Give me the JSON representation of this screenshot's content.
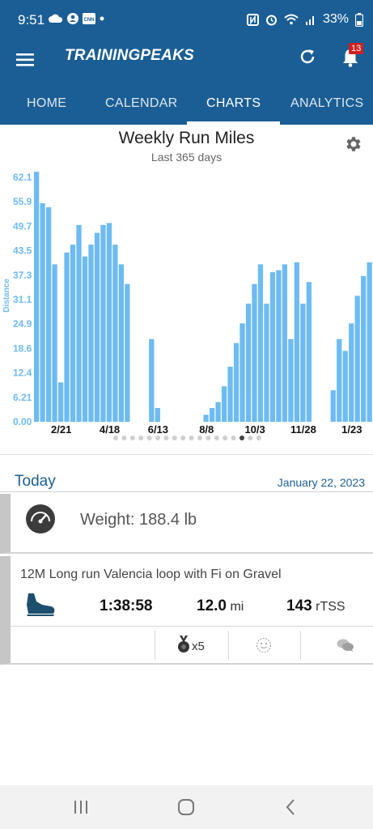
{
  "status": {
    "time": "9:51",
    "battery": "33%",
    "left_icons": [
      "cloud-icon",
      "account-icon",
      "cnn-icon",
      "dot-icon"
    ],
    "right_icons": [
      "nfc-icon",
      "alarm-icon",
      "wifi-icon",
      "signal-icon"
    ]
  },
  "header": {
    "brand": "TRAININGPEAKS",
    "notification_count": "13"
  },
  "tabs": [
    {
      "label": "HOME"
    },
    {
      "label": "CALENDAR"
    },
    {
      "label": "CHARTS",
      "active": true
    },
    {
      "label": "ANALYTICS"
    }
  ],
  "chart": {
    "title": "Weekly Run Miles",
    "subtitle": "Last 365 days",
    "page_dots": {
      "count": 18,
      "active_index": 15
    }
  },
  "chart_data": {
    "type": "bar",
    "title": "Weekly Run Miles",
    "subtitle": "Last 365 days",
    "xlabel": "",
    "ylabel": "Distance",
    "ylim": [
      0,
      62.1
    ],
    "y_ticks": [
      "0.00",
      "6.21",
      "12.4",
      "18.6",
      "24.9",
      "31.1",
      "37.3",
      "43.5",
      "49.7",
      "55.9",
      "62.1"
    ],
    "x_ticks": [
      "2/21",
      "4/18",
      "6/13",
      "8/8",
      "10/3",
      "11/28",
      "1/23"
    ],
    "bar_color": "#6dbbf2",
    "values": [
      63.5,
      55.5,
      54.5,
      40.0,
      10.0,
      43.0,
      45.0,
      50.0,
      42.0,
      45.0,
      48.0,
      50.0,
      50.5,
      45.0,
      40.0,
      35.0,
      0,
      0,
      0,
      21.0,
      3.5,
      0,
      0,
      0,
      0,
      0,
      0,
      0,
      1.8,
      3.5,
      5.0,
      9.0,
      14.0,
      20.0,
      25.0,
      30.0,
      35.0,
      40.0,
      30.0,
      38.0,
      38.5,
      40.0,
      21.0,
      40.5,
      30.0,
      35.5,
      0,
      0,
      0,
      8.0,
      21.0,
      18.0,
      25.0,
      32.0,
      37.0,
      40.5
    ]
  },
  "today": {
    "label": "Today",
    "date": "January 22, 2023"
  },
  "weight": {
    "text": "Weight: 188.4 lb",
    "icon": "scale-icon"
  },
  "workout": {
    "title": "12M Long run Valencia loop with Fi on Gravel",
    "duration": "1:38:58",
    "distance": "12.0",
    "distance_unit": "mi",
    "tss": "143",
    "tss_unit": "rTSS",
    "medal_count": "x5",
    "icon": "run-shoe-icon"
  },
  "colors": {
    "brand_blue": "#1b5e95",
    "bar_blue": "#6dbbf2",
    "accent_text": "#1b5e95"
  }
}
